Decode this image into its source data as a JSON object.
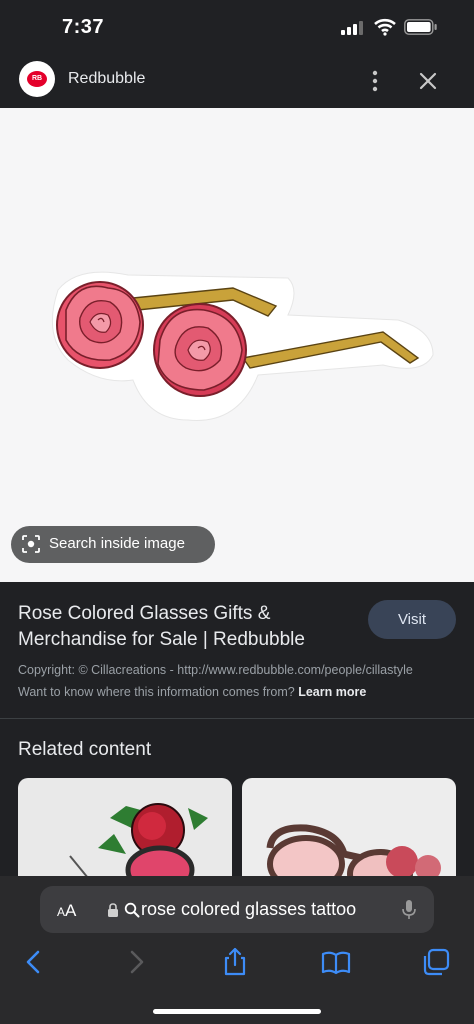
{
  "status_bar": {
    "time": "7:37"
  },
  "header": {
    "site_name": "Redbubble",
    "logo_text": "RB"
  },
  "image_panel": {
    "search_inside_label": "Search inside image"
  },
  "result": {
    "title": "Rose Colored Glasses Gifts & Merchandise for Sale | Redbubble",
    "visit_label": "Visit",
    "copyright": "Copyright: © Cillacreations - http://www.redbubble.com/people/cillastyle",
    "info_question": "Want to know where this information comes from?",
    "learn_more": "Learn more"
  },
  "related": {
    "heading": "Related content"
  },
  "browser": {
    "aa_label_small": "A",
    "aa_label_big": "A",
    "url_text": "rose colored glasses tattoo"
  },
  "icons": {
    "more": "more-vert-icon",
    "close": "close-icon",
    "lens": "lens-icon",
    "lock": "lock-icon",
    "search": "search-icon",
    "mic": "microphone-icon",
    "back": "chevron-left-icon",
    "forward": "chevron-right-icon",
    "share": "share-icon",
    "bookmarks": "book-icon",
    "tabs": "tabs-icon"
  },
  "colors": {
    "background": "#202124",
    "accent_blue": "#3d8cf7",
    "visit_button": "#394457",
    "brand_red": "#e4002b",
    "rose_pink": "#e8536b",
    "frame_gold": "#c9a23a"
  }
}
